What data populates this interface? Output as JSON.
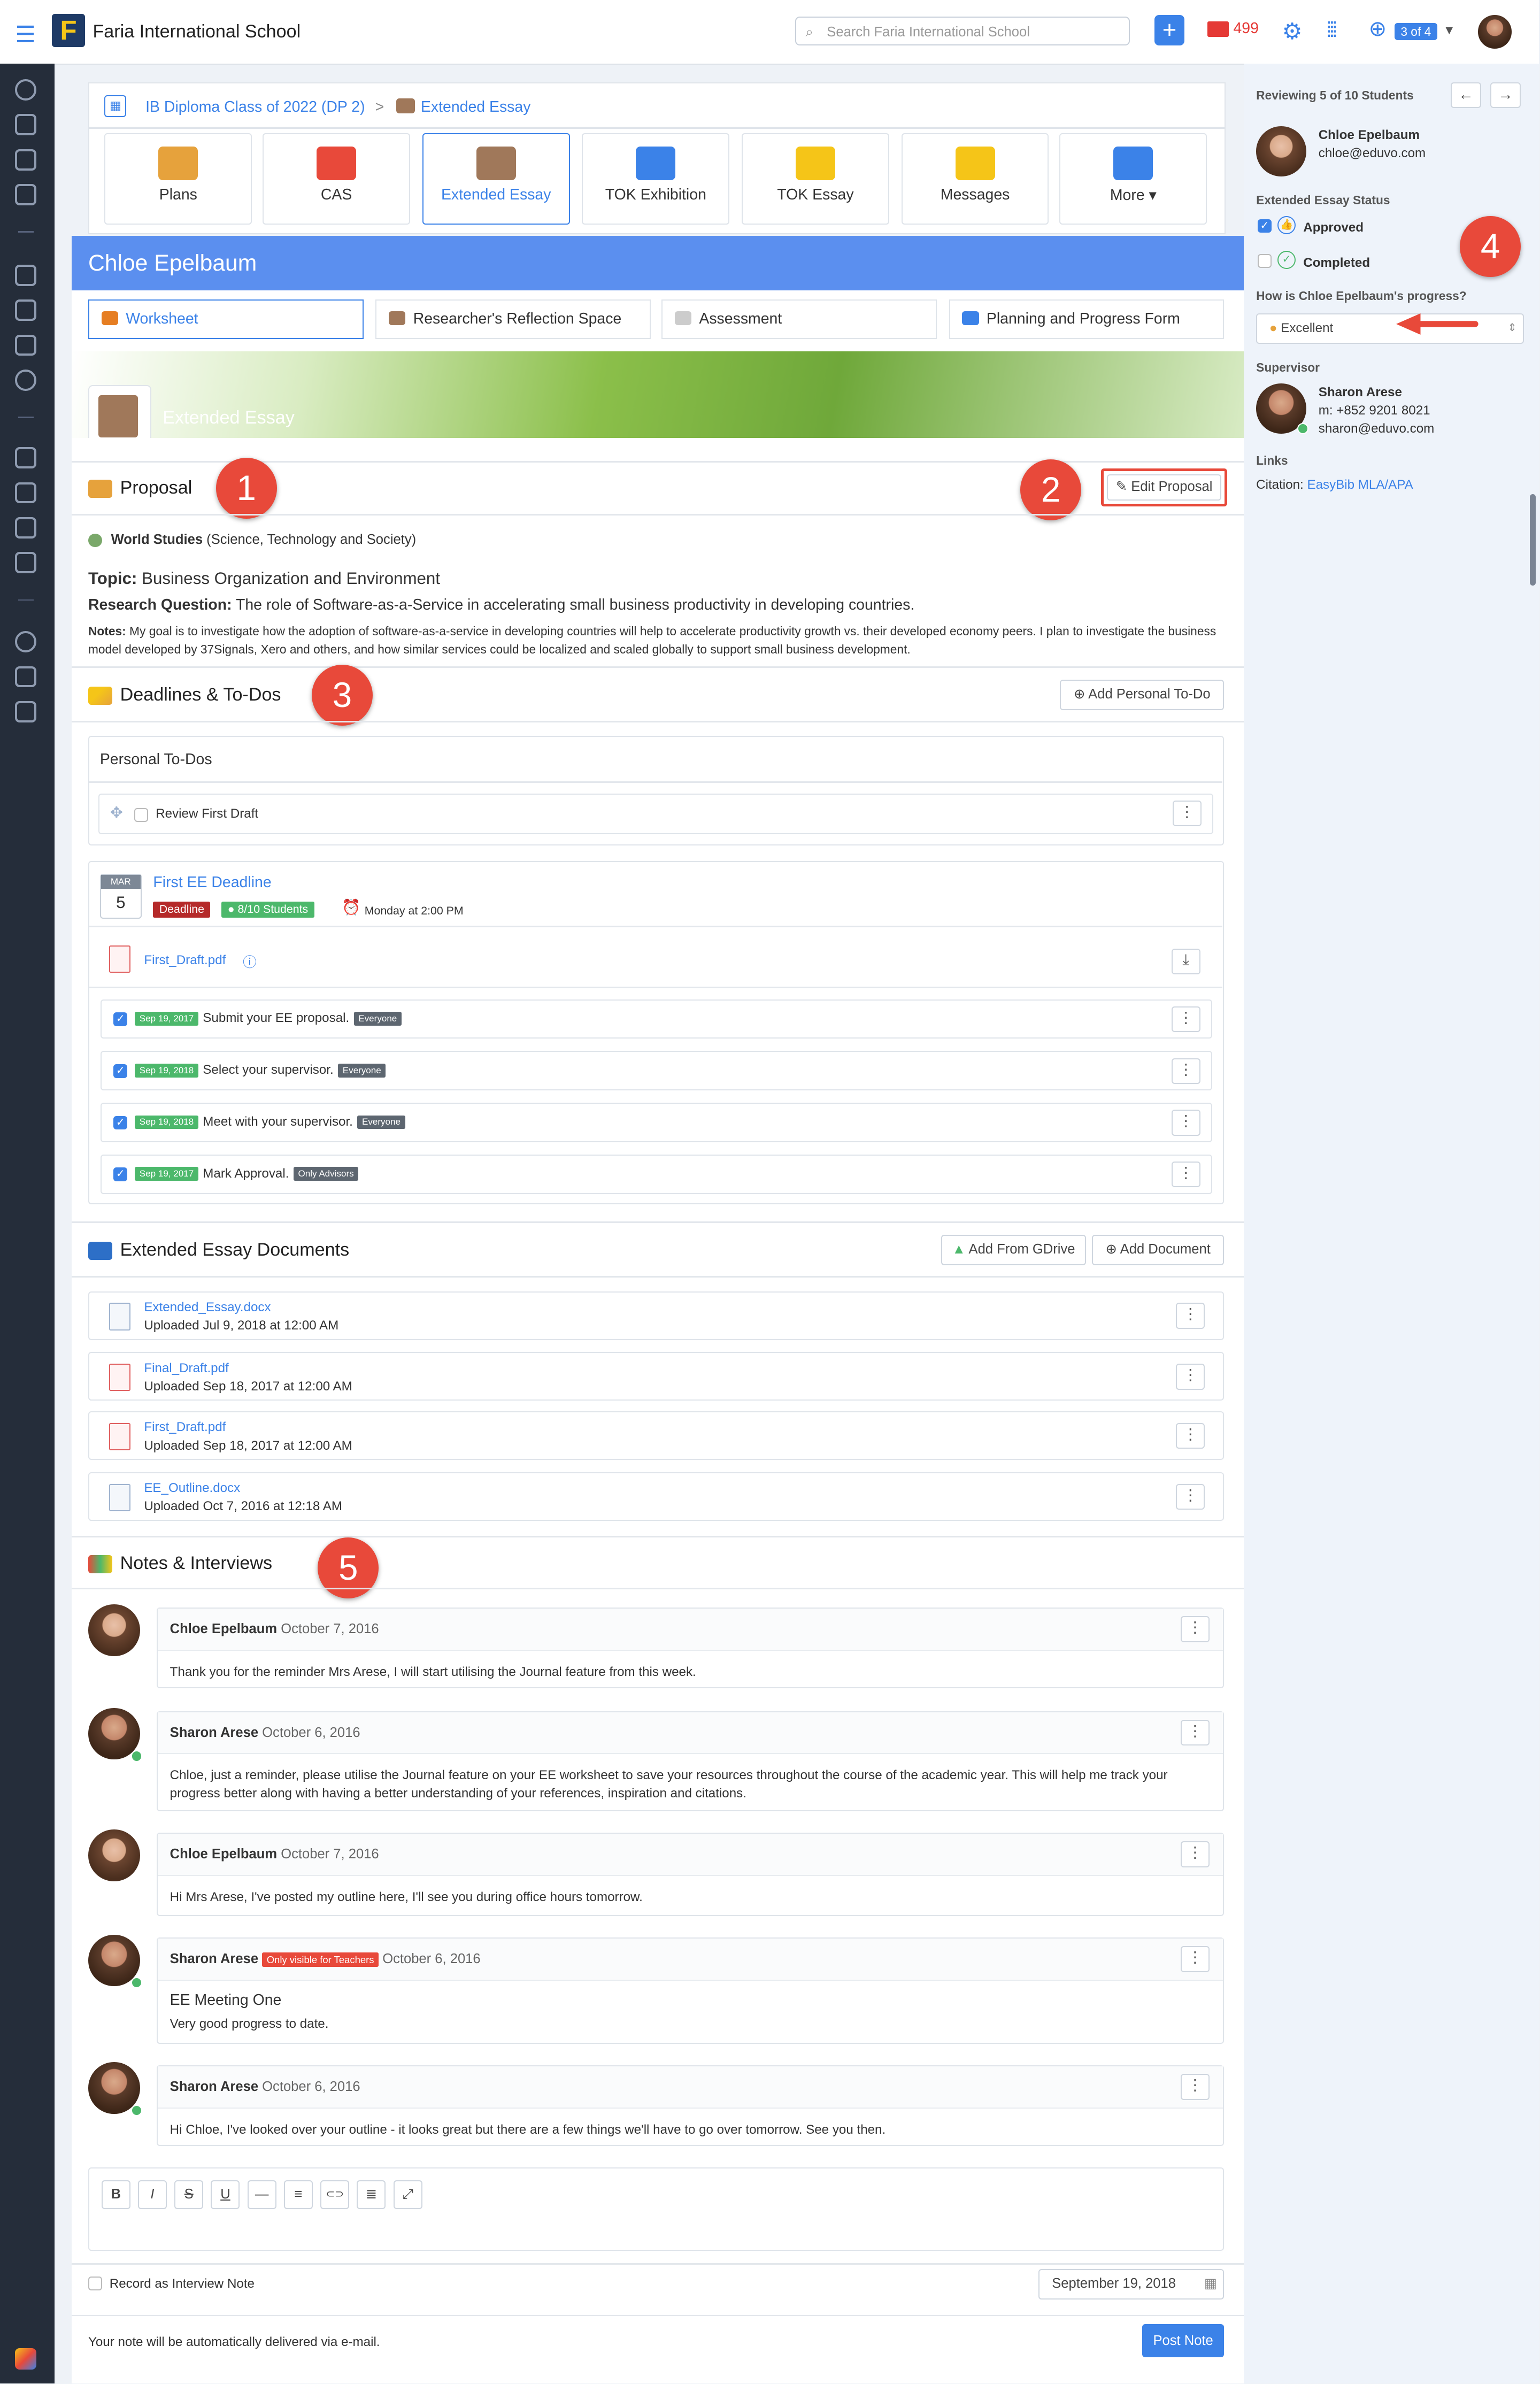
{
  "topbar": {
    "school": "Faria International School",
    "logo_letter": "F",
    "search_placeholder": "Search Faria International School",
    "mail_count": "499",
    "pager": "3 of 4"
  },
  "breadcrumb": {
    "class": "IB Diploma Class of 2022 (DP 2)",
    "sep": ">",
    "current": "Extended Essay"
  },
  "tabs": [
    {
      "label": "Plans",
      "color": "#e6a23c"
    },
    {
      "label": "CAS",
      "color": "#e8493a"
    },
    {
      "label": "Extended Essay",
      "color": "#a0785a"
    },
    {
      "label": "TOK Exhibition",
      "color": "#3b82e8"
    },
    {
      "label": "TOK Essay",
      "color": "#f5c518"
    },
    {
      "label": "Messages",
      "color": "#f5c518"
    },
    {
      "label": "More ▾",
      "color": "#3b82e8"
    }
  ],
  "student_name": "Chloe Epelbaum",
  "subtabs": [
    {
      "label": "Worksheet",
      "color": "#e67e22"
    },
    {
      "label": "Researcher's Reflection Space",
      "color": "#a0785a"
    },
    {
      "label": "Assessment",
      "color": "#bbbbbb"
    },
    {
      "label": "Planning and Progress Form",
      "color": "#3b82e8"
    }
  ],
  "banner_title": "Extended Essay",
  "proposal": {
    "heading": "Proposal",
    "edit_label": "Edit Proposal",
    "subject": "World Studies",
    "subject_detail": " (Science, Technology and Society)",
    "topic_label": "Topic:",
    "topic": " Business Organization and Environment",
    "rq_label": "Research Question:",
    "rq": " The role of Software-as-a-Service in accelerating small business productivity in developing countries.",
    "notes_label": "Notes:",
    "notes": " My goal is to investigate how the adoption of software-as-a-service in developing countries will help to accelerate productivity growth vs. their developed economy peers. I plan to investigate the business model developed by 37Signals, Xero and others, and how similar services could be localized and scaled globally to support small business development."
  },
  "callouts": [
    "1",
    "2",
    "3",
    "4",
    "5"
  ],
  "deadlines": {
    "heading": "Deadlines & To-Dos",
    "add_label": "Add Personal To-Do",
    "personal_heading": "Personal To-Dos",
    "personal_item": "Review First Draft",
    "month": "MAR",
    "day": "5",
    "title": "First EE Deadline",
    "deadline_tag": "Deadline",
    "students_tag": "8/10 Students",
    "time": "Monday at 2:00 PM",
    "file": "First_Draft.pdf",
    "items": [
      {
        "date": "Sep 19, 2017",
        "text": "Submit your EE proposal.",
        "tag": "Everyone"
      },
      {
        "date": "Sep 19, 2018",
        "text": "Select your supervisor.",
        "tag": "Everyone"
      },
      {
        "date": "Sep 19, 2018",
        "text": "Meet with your supervisor.",
        "tag": "Everyone"
      },
      {
        "date": "Sep 19, 2017",
        "text": "Mark Approval.",
        "tag": "Only Advisors"
      }
    ]
  },
  "documents": {
    "heading": "Extended Essay Documents",
    "gdrive_label": "Add From GDrive",
    "add_label": "Add Document",
    "files": [
      {
        "name": "Extended_Essay.docx",
        "uploaded": "Uploaded Jul 9, 2018 at 12:00 AM"
      },
      {
        "name": "Final_Draft.pdf",
        "uploaded": "Uploaded Sep 18, 2017 at 12:00 AM"
      },
      {
        "name": "First_Draft.pdf",
        "uploaded": "Uploaded Sep 18, 2017 at 12:00 AM"
      },
      {
        "name": "EE_Outline.docx",
        "uploaded": "Uploaded Oct 7, 2016 at 12:18 AM"
      }
    ]
  },
  "notes": {
    "heading": "Notes & Interviews",
    "items": [
      {
        "author": "Chloe Epelbaum",
        "date": "October 7, 2016",
        "title": "",
        "text": "Thank you for the reminder Mrs Arese, I will start utilising the Journal feature from this week.",
        "badge": ""
      },
      {
        "author": "Sharon Arese",
        "date": "October 6, 2016",
        "title": "",
        "text": "Chloe, just a reminder, please utilise the Journal feature on your EE worksheet to save your resources throughout the course of the academic year. This will help me track your progress better along with having a better understanding of your references, inspiration and citations.",
        "badge": ""
      },
      {
        "author": "Chloe Epelbaum",
        "date": "October 7, 2016",
        "title": "",
        "text": "Hi Mrs Arese, I've posted my outline here, I'll see you during office hours tomorrow.",
        "badge": ""
      },
      {
        "author": "Sharon Arese",
        "date": "October 6, 2016",
        "title": "EE Meeting One",
        "text": "Very good progress to date.",
        "badge": "Only visible for Teachers"
      },
      {
        "author": "Sharon Arese",
        "date": "October 6, 2016",
        "title": "",
        "text": "Hi Chloe, I've looked over your outline - it looks great but there are a few things we'll have to go over tomorrow. See you then.",
        "badge": ""
      }
    ],
    "record_label": "Record as Interview Note",
    "date_value": "September 19, 2018",
    "email_notice": "Your note will be automatically delivered via e-mail.",
    "post_label": "Post Note",
    "toolbar": [
      "B",
      "I",
      "S",
      "U",
      "—",
      "≡",
      "⊂⊃",
      "≣",
      "⤢"
    ]
  },
  "sidebar": {
    "reviewing": "Reviewing 5 of 10 Students",
    "student_name": "Chloe Epelbaum",
    "student_email": "chloe@eduvo.com",
    "status_label": "Extended Essay Status",
    "approved": "Approved",
    "completed": "Completed",
    "progress_q": "How is Chloe Epelbaum's progress?",
    "progress_value": "Excellent",
    "supervisor_label": "Supervisor",
    "sup_name": "Sharon Arese",
    "sup_phone": "m: +852 9201 8021",
    "sup_email": "sharon@eduvo.com",
    "links_label": "Links",
    "citation_label": "Citation: ",
    "citation_link": "EasyBib MLA/APA"
  },
  "colors": {
    "accent": "#3b82e8",
    "header": "#5b8fef",
    "callout": "#e8493a"
  }
}
